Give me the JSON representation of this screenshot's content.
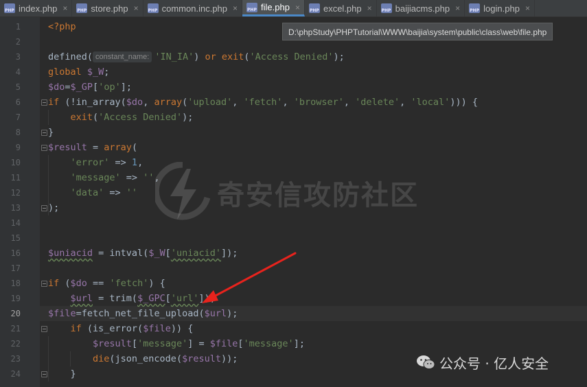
{
  "tabs": [
    {
      "label": "index.php",
      "active": false
    },
    {
      "label": "store.php",
      "active": false
    },
    {
      "label": "common.inc.php",
      "active": false
    },
    {
      "label": "file.php",
      "active": true
    },
    {
      "label": "excel.php",
      "active": false
    },
    {
      "label": "baijiacms.php",
      "active": false
    },
    {
      "label": "login.php",
      "active": false
    }
  ],
  "tooltip": {
    "path": "D:\\phpStudy\\PHPTutorial\\WWW\\baijia\\system\\public\\class\\web\\file.php"
  },
  "editor": {
    "current_line": 20,
    "line_numbers": [
      "1",
      "2",
      "3",
      "4",
      "5",
      "6",
      "7",
      "8",
      "9",
      "10",
      "11",
      "12",
      "13",
      "14",
      "15",
      "16",
      "17",
      "18",
      "19",
      "20",
      "21",
      "22",
      "23",
      "24"
    ],
    "inlay_hint": "constant_name:",
    "lines": [
      [
        {
          "t": "<?php",
          "c": "kw"
        }
      ],
      [],
      [
        {
          "t": "defined(",
          "c": "plain"
        },
        {
          "t": "HINT"
        },
        {
          "t": "'IN_IA'",
          "c": "str"
        },
        {
          "t": ") ",
          "c": "plain"
        },
        {
          "t": "or ",
          "c": "kw"
        },
        {
          "t": "exit",
          "c": "kw"
        },
        {
          "t": "(",
          "c": "plain"
        },
        {
          "t": "'Access Denied'",
          "c": "str"
        },
        {
          "t": ");",
          "c": "plain"
        }
      ],
      [
        {
          "t": "global ",
          "c": "kw"
        },
        {
          "t": "$_W",
          "c": "var"
        },
        {
          "t": ";",
          "c": "plain"
        }
      ],
      [
        {
          "t": "$do",
          "c": "var"
        },
        {
          "t": "=",
          "c": "plain"
        },
        {
          "t": "$_GP",
          "c": "var"
        },
        {
          "t": "[",
          "c": "plain"
        },
        {
          "t": "'op'",
          "c": "str"
        },
        {
          "t": "];",
          "c": "plain"
        }
      ],
      [
        {
          "t": "if ",
          "c": "kw"
        },
        {
          "t": "(!in_array(",
          "c": "plain"
        },
        {
          "t": "$do",
          "c": "var"
        },
        {
          "t": ", ",
          "c": "plain"
        },
        {
          "t": "array",
          "c": "kw"
        },
        {
          "t": "(",
          "c": "plain"
        },
        {
          "t": "'upload'",
          "c": "str"
        },
        {
          "t": ", ",
          "c": "plain"
        },
        {
          "t": "'fetch'",
          "c": "str"
        },
        {
          "t": ", ",
          "c": "plain"
        },
        {
          "t": "'browser'",
          "c": "str"
        },
        {
          "t": ", ",
          "c": "plain"
        },
        {
          "t": "'delete'",
          "c": "str"
        },
        {
          "t": ", ",
          "c": "plain"
        },
        {
          "t": "'local'",
          "c": "str"
        },
        {
          "t": "))) {",
          "c": "plain"
        }
      ],
      [
        {
          "t": "    exit",
          "c": "kw"
        },
        {
          "t": "(",
          "c": "plain"
        },
        {
          "t": "'Access Denied'",
          "c": "str"
        },
        {
          "t": ");",
          "c": "plain"
        }
      ],
      [
        {
          "t": "}",
          "c": "plain"
        }
      ],
      [
        {
          "t": "$result",
          "c": "var"
        },
        {
          "t": " = ",
          "c": "plain"
        },
        {
          "t": "array",
          "c": "kw"
        },
        {
          "t": "(",
          "c": "plain"
        }
      ],
      [
        {
          "t": "    'error'",
          "c": "str"
        },
        {
          "t": " => ",
          "c": "plain"
        },
        {
          "t": "1",
          "c": "num"
        },
        {
          "t": ",",
          "c": "plain"
        }
      ],
      [
        {
          "t": "    'message'",
          "c": "str"
        },
        {
          "t": " => ",
          "c": "plain"
        },
        {
          "t": "''",
          "c": "str"
        },
        {
          "t": ",",
          "c": "plain"
        }
      ],
      [
        {
          "t": "    'data'",
          "c": "str"
        },
        {
          "t": " => ",
          "c": "plain"
        },
        {
          "t": "''",
          "c": "str"
        }
      ],
      [
        {
          "t": ");",
          "c": "plain"
        }
      ],
      [],
      [],
      [
        {
          "t": "$uniacid",
          "c": "var"
        },
        {
          "t": " = intval(",
          "c": "plain"
        },
        {
          "t": "$_W",
          "c": "var"
        },
        {
          "t": "[",
          "c": "plain"
        },
        {
          "t": "'uniacid'",
          "c": "str"
        },
        {
          "t": "]);",
          "c": "plain"
        }
      ],
      [],
      [
        {
          "t": "if ",
          "c": "kw"
        },
        {
          "t": "(",
          "c": "plain"
        },
        {
          "t": "$do",
          "c": "var"
        },
        {
          "t": " == ",
          "c": "plain"
        },
        {
          "t": "'fetch'",
          "c": "str"
        },
        {
          "t": ") {",
          "c": "plain"
        }
      ],
      [
        {
          "t": "    ",
          "c": "plain"
        },
        {
          "t": "$url",
          "c": "var"
        },
        {
          "t": " = trim(",
          "c": "plain"
        },
        {
          "t": "$_GPC",
          "c": "var"
        },
        {
          "t": "[",
          "c": "plain"
        },
        {
          "t": "'url'",
          "c": "str"
        },
        {
          "t": "]);",
          "c": "plain"
        }
      ],
      [
        {
          "t": "$file",
          "c": "var"
        },
        {
          "t": "=",
          "c": "plain"
        },
        {
          "t": "fetch_net_file_upload",
          "c": "plain"
        },
        {
          "t": "(",
          "c": "plain"
        },
        {
          "t": "$url",
          "c": "var"
        },
        {
          "t": ");",
          "c": "plain"
        }
      ],
      [
        {
          "t": "    if ",
          "c": "kw"
        },
        {
          "t": "(is_error(",
          "c": "plain"
        },
        {
          "t": "$file",
          "c": "var"
        },
        {
          "t": ")) {",
          "c": "plain"
        }
      ],
      [
        {
          "t": "        ",
          "c": "plain"
        },
        {
          "t": "$result",
          "c": "var"
        },
        {
          "t": "[",
          "c": "plain"
        },
        {
          "t": "'message'",
          "c": "str"
        },
        {
          "t": "] = ",
          "c": "plain"
        },
        {
          "t": "$file",
          "c": "var"
        },
        {
          "t": "[",
          "c": "plain"
        },
        {
          "t": "'message'",
          "c": "str"
        },
        {
          "t": "];",
          "c": "plain"
        }
      ],
      [
        {
          "t": "        die",
          "c": "kw"
        },
        {
          "t": "(json_encode(",
          "c": "plain"
        },
        {
          "t": "$result",
          "c": "var"
        },
        {
          "t": "));",
          "c": "plain"
        }
      ],
      [
        {
          "t": "    }",
          "c": "plain"
        }
      ]
    ]
  },
  "watermark": {
    "text": "奇安信攻防社区"
  },
  "footer": {
    "text": "公众号 · 亿人安全"
  },
  "colors": {
    "keyword": "#cc7832",
    "variable": "#9876aa",
    "string": "#6a8759",
    "number": "#6897bb",
    "arrow": "#e8231d",
    "background": "#2b2b2b"
  }
}
